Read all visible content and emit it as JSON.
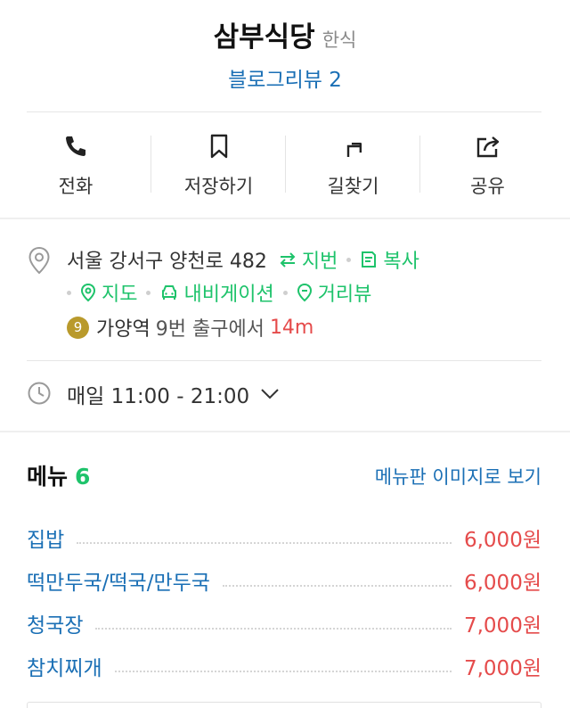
{
  "place": {
    "name": "삼부식당",
    "category": "한식",
    "review_link": "블로그리뷰 2"
  },
  "actions": [
    {
      "label": "전화",
      "icon": "phone-icon"
    },
    {
      "label": "저장하기",
      "icon": "bookmark-icon"
    },
    {
      "label": "길찾기",
      "icon": "directions-icon"
    },
    {
      "label": "공유",
      "icon": "share-icon"
    }
  ],
  "address": {
    "text": "서울 강서구 양천로 482",
    "jibun_label": "지번",
    "copy_label": "복사",
    "map_label": "지도",
    "navigation_label": "내비게이션",
    "street_view_label": "거리뷰"
  },
  "subway": {
    "line": "9",
    "station": "가양역",
    "exit": "9번 출구에서",
    "distance": "14m"
  },
  "hours": {
    "text": "매일 11:00 - 21:00"
  },
  "menu": {
    "title": "메뉴",
    "count": "6",
    "view_board_link": "메뉴판 이미지로 보기",
    "items": [
      {
        "name": "집밥",
        "price": "6,000원"
      },
      {
        "name": "떡만두국/떡국/만두국",
        "price": "6,000원"
      },
      {
        "name": "청국장",
        "price": "7,000원"
      },
      {
        "name": "참치찌개",
        "price": "7,000원"
      }
    ]
  },
  "colors": {
    "link_blue": "#1a6fb5",
    "accent_green": "#1ec36b",
    "price_red": "#e54b4b",
    "subway_line_9": "#b99a2c"
  }
}
